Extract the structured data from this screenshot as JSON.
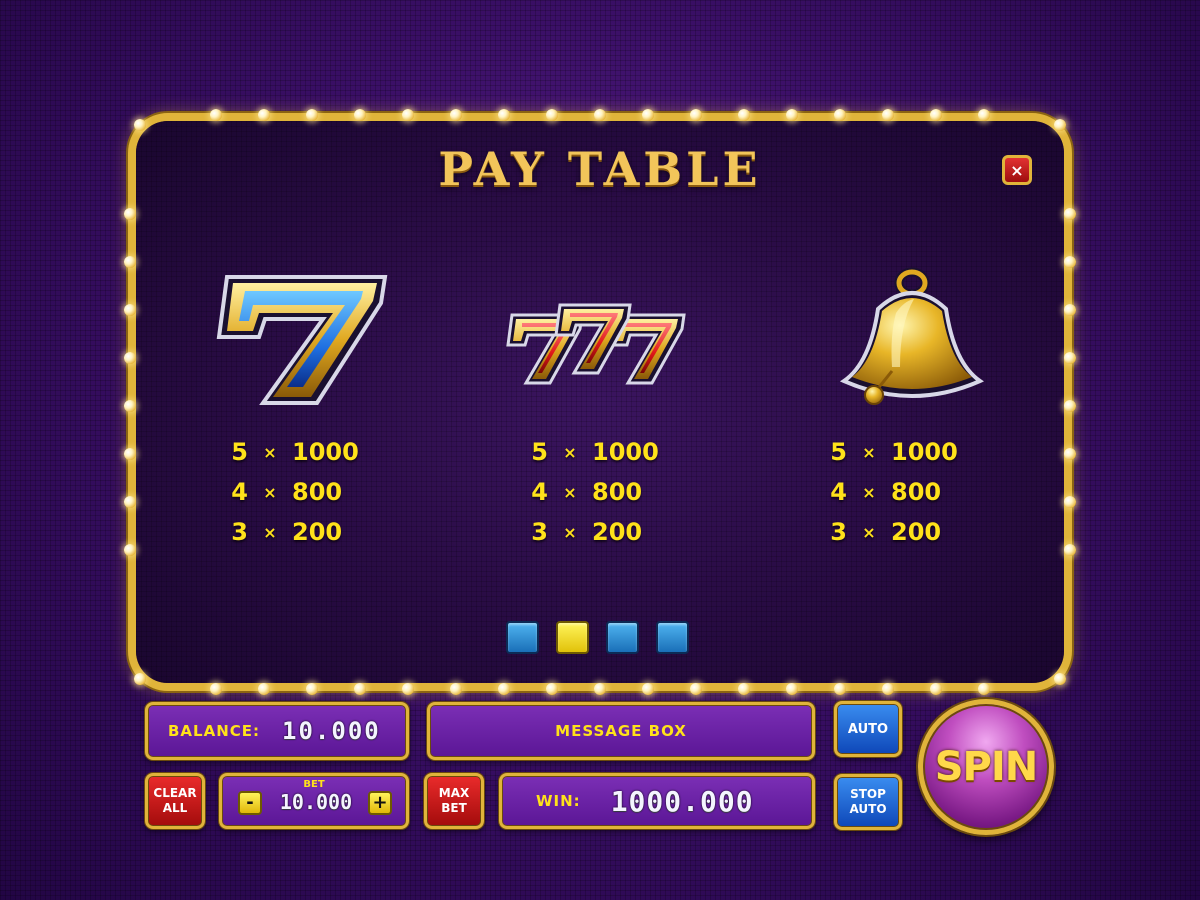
{
  "paytable": {
    "title": "PAY TABLE",
    "close_icon": "×",
    "symbols": [
      {
        "name": "blue-seven",
        "rows": [
          {
            "count": "5",
            "x": "×",
            "payout": "1000"
          },
          {
            "count": "4",
            "x": "×",
            "payout": "800"
          },
          {
            "count": "3",
            "x": "×",
            "payout": "200"
          }
        ]
      },
      {
        "name": "triple-red-seven",
        "rows": [
          {
            "count": "5",
            "x": "×",
            "payout": "1000"
          },
          {
            "count": "4",
            "x": "×",
            "payout": "800"
          },
          {
            "count": "3",
            "x": "×",
            "payout": "200"
          }
        ]
      },
      {
        "name": "golden-bell",
        "rows": [
          {
            "count": "5",
            "x": "×",
            "payout": "1000"
          },
          {
            "count": "4",
            "x": "×",
            "payout": "800"
          },
          {
            "count": "3",
            "x": "×",
            "payout": "200"
          }
        ]
      }
    ],
    "page_dots": 4,
    "active_page": 2
  },
  "controls": {
    "balance_label": "BALANCE:",
    "balance_value": "10.000",
    "message": "MESSAGE BOX",
    "auto": "AUTO",
    "stop_auto": "STOP\nAUTO",
    "clear_all": "CLEAR\nALL",
    "bet_label": "BET",
    "bet_value": "10.000",
    "bet_minus": "-",
    "bet_plus": "+",
    "max_bet": "MAX\nBET",
    "win_label": "WIN:",
    "win_value": "1000.000",
    "spin": "SPIN"
  },
  "colors": {
    "gold_frame": "#e0b43a",
    "payout_yellow": "#ffe21a",
    "panel_purple": "#2a0c46",
    "button_red": "#ea2b2b",
    "button_blue": "#1a6fb8"
  }
}
